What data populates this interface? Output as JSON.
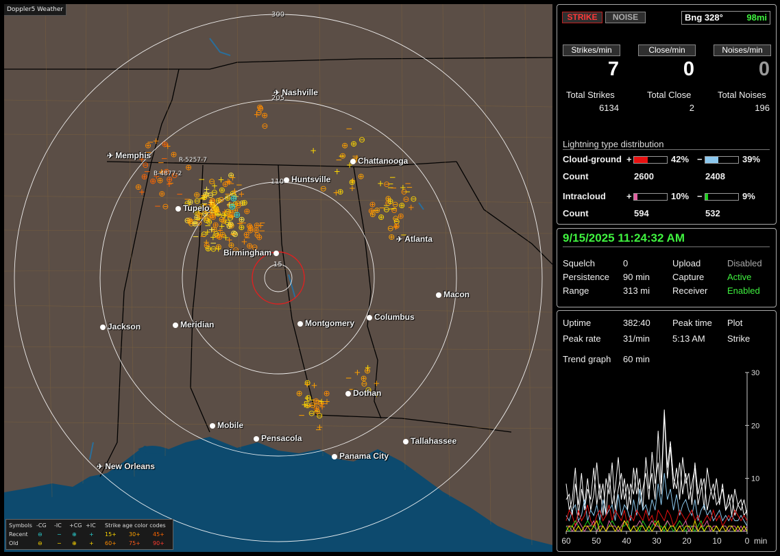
{
  "window_title": "Doppler5 Weather",
  "map": {
    "ring_labels": {
      "r300": "300",
      "r205": "205",
      "r110": "110",
      "r15": "15"
    },
    "stations": [
      {
        "id": "r5257",
        "label": "R-5257-7"
      },
      {
        "id": "b4877",
        "label": "B-4877-2"
      }
    ],
    "cities": [
      {
        "key": "nashville",
        "name": "Nashville",
        "airport": true
      },
      {
        "key": "memphis",
        "name": "Memphis",
        "airport": true
      },
      {
        "key": "chattanooga",
        "name": "Chattanooga",
        "airport": false
      },
      {
        "key": "huntsville",
        "name": "Huntsville",
        "airport": false
      },
      {
        "key": "tupelo",
        "name": "Tupelo",
        "airport": false
      },
      {
        "key": "atlanta",
        "name": "Atlanta",
        "airport": true
      },
      {
        "key": "birmingham",
        "name": "Birmingham",
        "airport": false
      },
      {
        "key": "macon",
        "name": "Macon",
        "airport": false
      },
      {
        "key": "jackson",
        "name": "Jackson",
        "airport": false
      },
      {
        "key": "meridian",
        "name": "Meridian",
        "airport": false
      },
      {
        "key": "montgomery",
        "name": "Montgomery",
        "airport": false
      },
      {
        "key": "columbus",
        "name": "Columbus",
        "airport": false
      },
      {
        "key": "dotham",
        "name": "Dothan",
        "airport": false
      },
      {
        "key": "mobile",
        "name": "Mobile",
        "airport": false
      },
      {
        "key": "pensacola",
        "name": "Pensacola",
        "airport": false
      },
      {
        "key": "tallahassee",
        "name": "Tallahassee",
        "airport": false
      },
      {
        "key": "panama",
        "name": "Panama City",
        "airport": false
      },
      {
        "key": "neworleans",
        "name": "New Orleans",
        "airport": true
      }
    ]
  },
  "legend": {
    "header": [
      "Symbols",
      "-CG",
      "-IC",
      "+CG",
      "+IC",
      "Strike age color codes"
    ],
    "recent": {
      "label": "Recent",
      "ages": [
        "15+",
        "30+",
        "45+"
      ]
    },
    "old": {
      "label": "Old",
      "ages": [
        "60+",
        "75+",
        "90+"
      ]
    },
    "colors": {
      "15+": "#ffd800",
      "30+": "#ffa200",
      "45+": "#ff6600",
      "60+": "#ff8c00",
      "75+": "#ff5a1a",
      "90+": "#ff3b2f"
    }
  },
  "top_panel": {
    "strike_btn": "STRIKE",
    "noise_btn": "NOISE",
    "bearing_label": "Bng 328°",
    "bearing_distance": "98mi",
    "rates": [
      {
        "label": "Strikes/min",
        "value": "7",
        "total_label": "Total Strikes",
        "total": "6134"
      },
      {
        "label": "Close/min",
        "value": "0",
        "total_label": "Total Close",
        "total": "2"
      },
      {
        "label": "Noises/min",
        "value": "0",
        "total_label": "Total Noises",
        "total": "196"
      }
    ],
    "distribution": {
      "title": "Lightning type distribution",
      "cg_label": "Cloud-ground",
      "ic_label": "Intracloud",
      "count_label": "Count",
      "plus": "+",
      "minus": "−",
      "cg_plus_pct": "42%",
      "cg_plus_frac": 0.42,
      "cg_minus_pct": "39%",
      "cg_minus_frac": 0.39,
      "cg_plus_count": "2600",
      "cg_minus_count": "2408",
      "ic_plus_pct": "10%",
      "ic_plus_frac": 0.1,
      "ic_minus_pct": "9%",
      "ic_minus_frac": 0.09,
      "ic_plus_count": "594",
      "ic_minus_count": "532",
      "colors": {
        "cg_plus": "#e81010",
        "cg_minus": "#8cc8ee",
        "ic_plus": "#e060a0",
        "ic_minus": "#20d020"
      }
    }
  },
  "status_panel": {
    "datetime": "9/15/2025 11:24:32 AM",
    "rows": [
      {
        "k1": "Squelch",
        "v1": "0",
        "k2": "Upload",
        "v2": "Disabled"
      },
      {
        "k1": "Persistence",
        "v1": "90 min",
        "k2": "Capture",
        "v2": "Active"
      },
      {
        "k1": "Range",
        "v1": "313 mi",
        "k2": "Receiver",
        "v2": "Enabled"
      }
    ]
  },
  "trend_panel": {
    "uptime_label": "Uptime",
    "uptime": "382:40",
    "peak_time_label": "Peak time",
    "plot_label": "Plot",
    "peak_rate_label": "Peak rate",
    "peak_rate": "31/min",
    "peak_time": "5:13 AM",
    "plot_value": "Strike",
    "trend_label": "Trend graph",
    "trend_value": "60 min"
  },
  "chart_data": {
    "type": "line",
    "x_ticks": [
      "60",
      "50",
      "40",
      "30",
      "20",
      "10",
      "0"
    ],
    "x_unit": "min",
    "y_ticks": [
      "30",
      "20",
      "10"
    ],
    "xlim": [
      60,
      0
    ],
    "ylim": [
      0,
      30
    ],
    "series": [
      {
        "color": "#ffffff",
        "values": [
          9,
          4,
          6,
          12,
          3,
          8,
          5,
          10,
          4,
          7,
          13,
          6,
          9,
          3,
          11,
          5,
          8,
          14,
          6,
          10,
          4,
          9,
          7,
          12,
          5,
          8,
          11,
          6,
          15,
          9,
          13,
          7,
          22,
          10,
          16,
          8,
          12,
          6,
          14,
          9,
          11,
          5,
          13,
          7,
          10,
          4,
          12,
          8,
          6,
          10,
          5,
          9,
          4,
          7,
          3,
          8,
          5,
          6,
          3,
          4
        ]
      },
      {
        "color": "#ffffff",
        "values": [
          6,
          7,
          3,
          9,
          5,
          11,
          4,
          8,
          6,
          12,
          5,
          9,
          3,
          10,
          7,
          13,
          4,
          8,
          11,
          6,
          9,
          5,
          12,
          7,
          10,
          4,
          14,
          8,
          11,
          6,
          19,
          9,
          23,
          12,
          17,
          10,
          8,
          13,
          7,
          11,
          6,
          9,
          12,
          5,
          8,
          10,
          4,
          7,
          9,
          5,
          6,
          8,
          4,
          5,
          7,
          3,
          5,
          4,
          6,
          3
        ]
      },
      {
        "color": "#8cc8ee",
        "values": [
          3,
          2,
          4,
          5,
          2,
          3,
          6,
          2,
          4,
          3,
          5,
          2,
          6,
          3,
          4,
          5,
          2,
          7,
          3,
          5,
          4,
          2,
          6,
          3,
          8,
          4,
          5,
          3,
          6,
          4,
          9,
          5,
          11,
          6,
          8,
          4,
          7,
          3,
          5,
          6,
          4,
          3,
          6,
          2,
          4,
          5,
          3,
          4,
          2,
          3,
          4,
          2,
          3,
          2,
          3,
          2,
          2,
          3,
          2,
          1
        ]
      },
      {
        "color": "#e81010",
        "values": [
          2,
          4,
          3,
          1,
          4,
          2,
          3,
          5,
          2,
          1,
          3,
          4,
          2,
          3,
          5,
          2,
          4,
          3,
          2,
          4,
          1,
          3,
          2,
          4,
          3,
          2,
          4,
          2,
          3,
          1,
          4,
          3,
          2,
          4,
          3,
          1,
          2,
          4,
          3,
          2,
          3,
          4,
          2,
          3,
          1,
          2,
          3,
          2,
          4,
          2,
          3,
          1,
          2,
          3,
          2,
          4,
          3,
          2,
          3,
          2
        ]
      },
      {
        "color": "#20d020",
        "values": [
          1,
          0,
          1,
          2,
          1,
          0,
          1,
          2,
          1,
          1,
          0,
          2,
          1,
          0,
          1,
          2,
          1,
          0,
          1,
          1,
          2,
          0,
          1,
          1,
          0,
          2,
          1,
          0,
          1,
          2,
          1,
          1,
          0,
          2,
          1,
          0,
          1,
          2,
          1,
          0,
          1,
          1,
          0,
          1,
          2,
          0,
          1,
          1,
          0,
          1,
          0,
          1,
          1,
          0,
          1,
          0,
          1,
          0,
          1,
          0
        ]
      },
      {
        "color": "#e060a0",
        "values": [
          1,
          1,
          0,
          1,
          2,
          1,
          0,
          1,
          1,
          2,
          0,
          1,
          1,
          0,
          2,
          1,
          1,
          0,
          1,
          2,
          1,
          0,
          1,
          1,
          2,
          1,
          0,
          1,
          2,
          1,
          1,
          0,
          1,
          2,
          1,
          1,
          0,
          1,
          1,
          2,
          0,
          1,
          1,
          0,
          1,
          1,
          2,
          0,
          1,
          1,
          0,
          1,
          1,
          0,
          1,
          1,
          0,
          1,
          0,
          1
        ]
      },
      {
        "color": "#f0e000",
        "values": [
          0,
          1,
          1,
          0,
          1,
          0,
          1,
          1,
          0,
          1,
          2,
          0,
          1,
          0,
          1,
          1,
          0,
          1,
          0,
          2,
          1,
          0,
          1,
          0,
          1,
          1,
          0,
          1,
          0,
          1,
          2,
          0,
          1,
          0,
          1,
          1,
          0,
          1,
          0,
          1,
          1,
          0,
          2,
          0,
          1,
          0,
          1,
          1,
          0,
          1,
          0,
          1,
          0,
          1,
          1,
          0,
          1,
          0,
          1,
          0
        ]
      }
    ]
  }
}
